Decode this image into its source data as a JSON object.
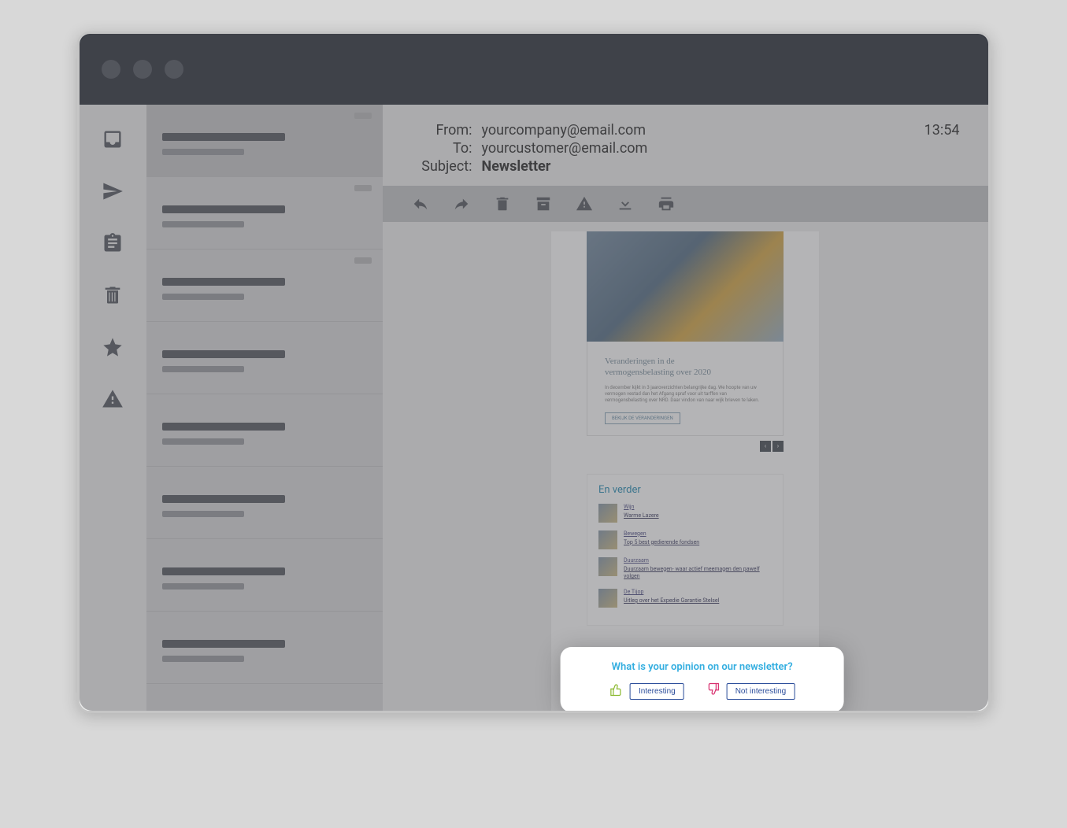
{
  "header": {
    "from_label": "From:",
    "from_value": "yourcompany@email.com",
    "to_label": "To:",
    "to_value": "yourcustomer@email.com",
    "subject_label": "Subject:",
    "subject_value": "Newsletter",
    "time": "13:54"
  },
  "newsletter": {
    "hero_title_1": "Veranderingen in de",
    "hero_title_2": "vermogensbelasting over 2020",
    "hero_text": "In december kijkt in 3 jaaroverzichten belangrijke dag. We hoopte van uw vermogen vestad dan het Afgang spraf voor uit tarffen van vermogensbelasting over NRD. Daar vindon van naar wijk brieven te laken.",
    "hero_cta": "BEKIJK DE VERANDERINGEN",
    "sidebar_title": "En verder",
    "items": [
      {
        "category": "Wijn",
        "link": "Warme Lazere"
      },
      {
        "category": "Bewegen",
        "link": "Top 5 best gedierende fondsen"
      },
      {
        "category": "Duurzaam",
        "link": "Duurzaam bewegen- waar actief meemagen den pawelf volgen"
      },
      {
        "category": "De Tijop",
        "link": "Uitleg over het Expedie Garantie Stelsel"
      }
    ]
  },
  "feedback": {
    "question": "What is your opinion on our newsletter?",
    "positive_label": "Interesting",
    "negative_label": "Not interesting"
  }
}
